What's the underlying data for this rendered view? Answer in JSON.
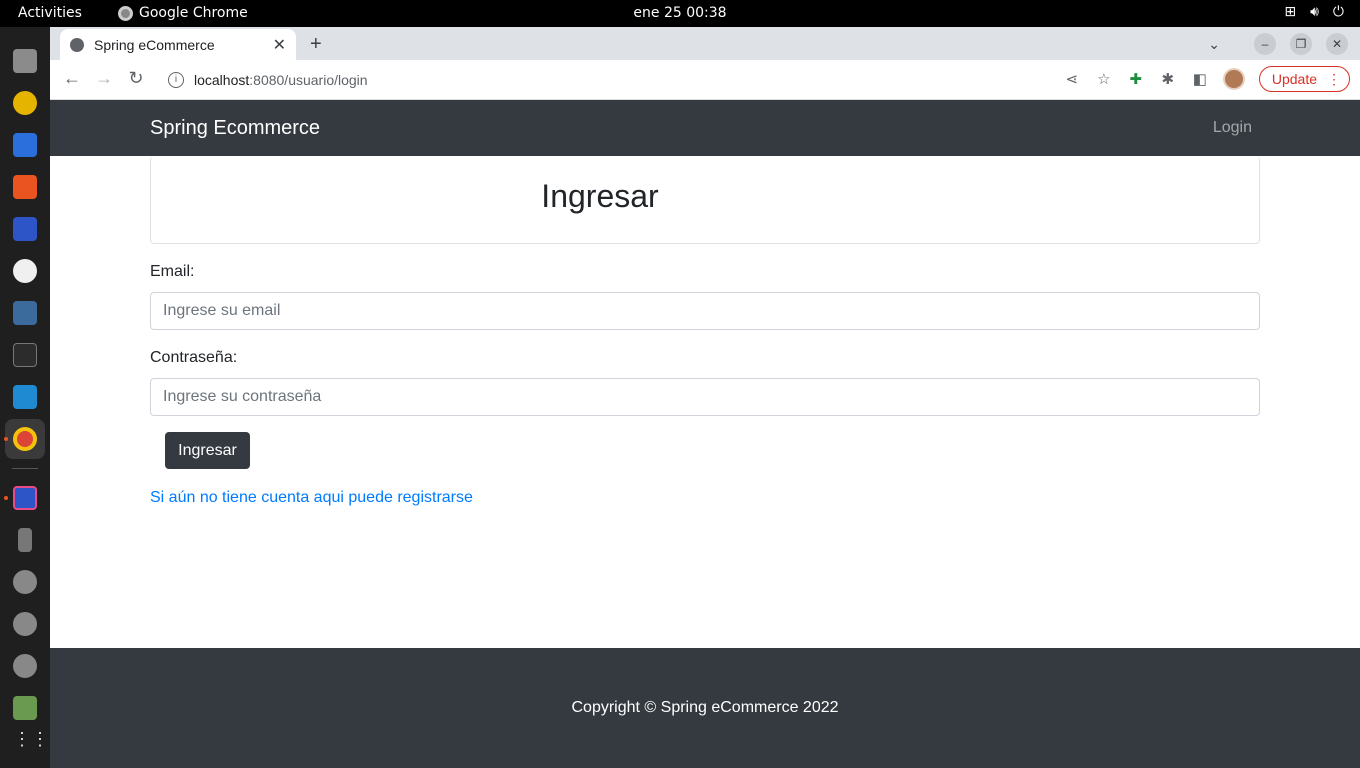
{
  "system": {
    "activities": "Activities",
    "app_name": "Google Chrome",
    "clock": "ene 25  00:38"
  },
  "browser": {
    "tab_title": "Spring eCommerce",
    "url_host": "localhost",
    "url_rest": ":8080/usuario/login",
    "update_label": "Update"
  },
  "navbar": {
    "brand": "Spring Ecommerce",
    "login": "Login"
  },
  "form": {
    "heading": "Ingresar",
    "email_label": "Email:",
    "email_placeholder": "Ingrese su email",
    "password_label": "Contraseña:",
    "password_placeholder": "Ingrese su contraseña",
    "submit_label": "Ingresar",
    "register_link": "Si aún no tiene cuenta aqui puede registrarse"
  },
  "footer": {
    "copyright": "Copyright © Spring eCommerce 2022"
  },
  "colors": {
    "navbar_bg": "#343a40",
    "link": "#007bff"
  }
}
